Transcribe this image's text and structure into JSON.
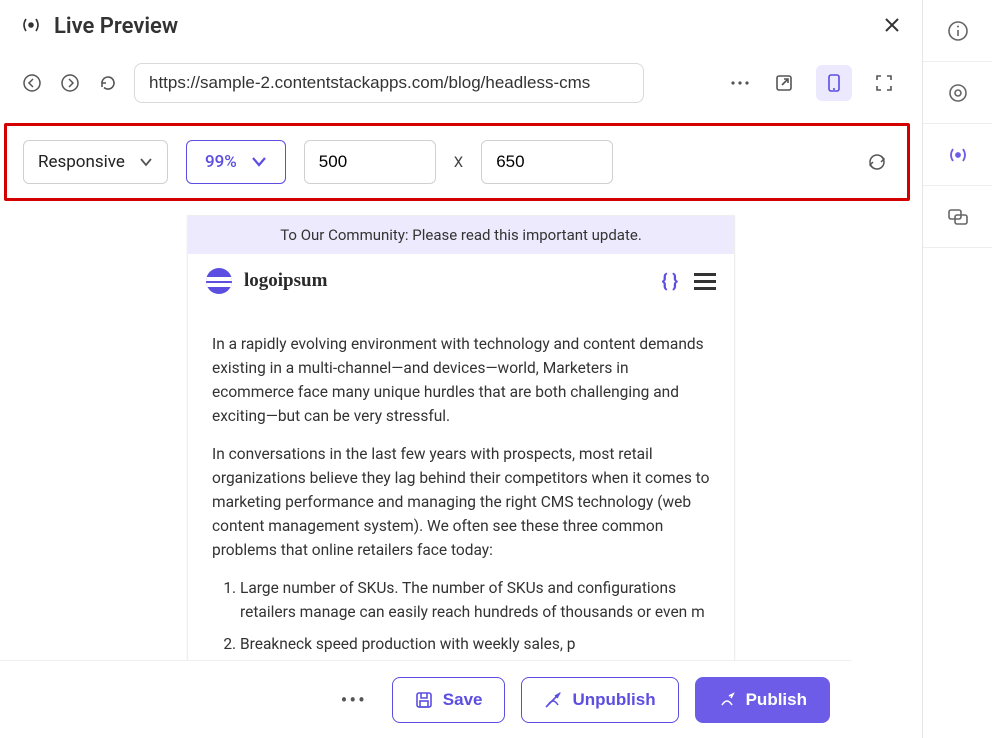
{
  "header": {
    "title": "Live Preview"
  },
  "url": {
    "value": "https://sample-2.contentstackapps.com/blog/headless-cms"
  },
  "controls": {
    "device": "Responsive",
    "zoom": "99%",
    "width": "500",
    "height": "650"
  },
  "preview": {
    "banner": "To Our Community: Please read this important update.",
    "logo": "logoipsum",
    "para1": "In a rapidly evolving environment with technology and content demands existing in a multi-channel—and devices—world, Marketers in ecommerce face many unique hurdles that are both challenging and exciting—but can be very stressful.",
    "para2": "In conversations in the last few years with prospects, most retail organizations believe they lag behind their competitors when it comes to marketing performance and managing the right CMS technology (web content management system). We often see these three common problems that online retailers face today:",
    "li1": "Large number of SKUs. The number of SKUs and configurations retailers manage can easily reach hundreds of thousands or even m",
    "li2": "Breakneck speed production with weekly sales, p"
  },
  "footer": {
    "save": "Save",
    "unpublish": "Unpublish",
    "publish": "Publish"
  }
}
